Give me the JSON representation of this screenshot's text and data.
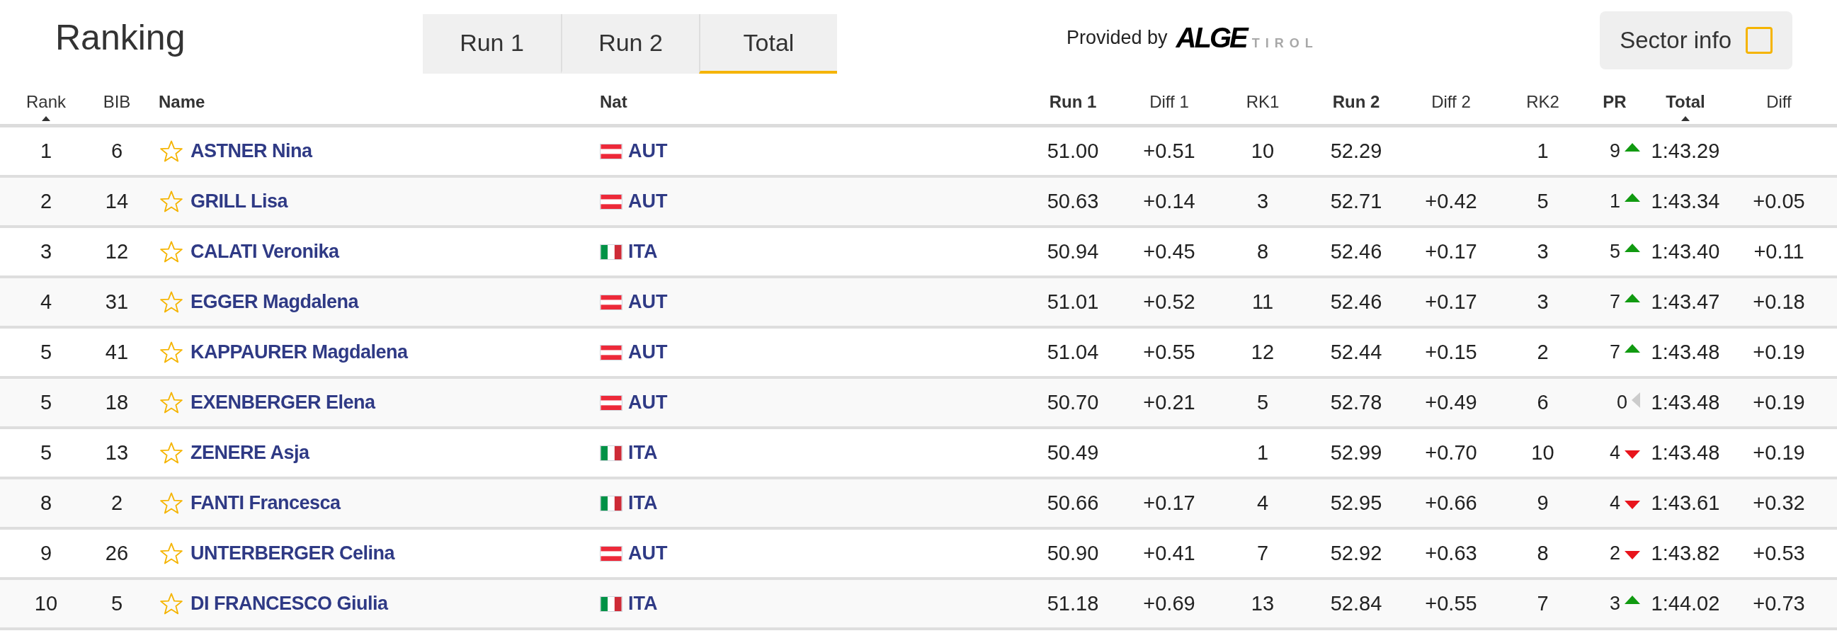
{
  "header": {
    "title": "Ranking",
    "tabs": [
      {
        "label": "Run 1",
        "selected": false
      },
      {
        "label": "Run 2",
        "selected": false
      },
      {
        "label": "Total",
        "selected": true
      }
    ],
    "provider": {
      "label": "Provided by",
      "logo_main": "ALGE",
      "logo_sub": "TIROL"
    },
    "sector_info": {
      "label": "Sector info",
      "checked": false
    }
  },
  "table": {
    "columns": [
      {
        "label": "Rank",
        "bold": false,
        "sorted": true
      },
      {
        "label": "BIB",
        "bold": false,
        "sorted": false
      },
      {
        "label": "Name",
        "bold": true,
        "sorted": false
      },
      {
        "label": "Nat",
        "bold": true,
        "sorted": false
      },
      {
        "label": "Run 1",
        "bold": true,
        "sorted": false
      },
      {
        "label": "Diff 1",
        "bold": false,
        "sorted": false
      },
      {
        "label": "RK1",
        "bold": false,
        "sorted": false
      },
      {
        "label": "Run 2",
        "bold": true,
        "sorted": false
      },
      {
        "label": "Diff 2",
        "bold": false,
        "sorted": false
      },
      {
        "label": "RK2",
        "bold": false,
        "sorted": false
      },
      {
        "label": "PR",
        "bold": true,
        "sorted": false
      },
      {
        "label": "Total",
        "bold": true,
        "sorted": true
      },
      {
        "label": "Diff",
        "bold": false,
        "sorted": false
      }
    ],
    "rows": [
      {
        "rank": "1",
        "bib": "6",
        "favorite": false,
        "name": "ASTNER Nina",
        "nation": {
          "kind": "austria",
          "code": "AUT"
        },
        "run1": "51.00",
        "diff1": "+0.51",
        "rk1": "10",
        "run2": "52.29",
        "rk2": "1",
        "pr": {
          "kind": "up",
          "places": "9"
        },
        "total": "1:43.29"
      },
      {
        "rank": "2",
        "bib": "14",
        "favorite": false,
        "name": "GRILL Lisa",
        "nation": {
          "kind": "austria",
          "code": "AUT"
        },
        "run1": "50.63",
        "diff1": "+0.14",
        "rk1": "3",
        "run2": "52.71",
        "diff2": "+0.42",
        "rk2": "5",
        "pr": {
          "kind": "up",
          "places": "1"
        },
        "total": "1:43.34",
        "diff": "+0.05"
      },
      {
        "rank": "3",
        "bib": "12",
        "favorite": false,
        "name": "CALATI Veronika",
        "nation": {
          "kind": "italy",
          "code": "ITA"
        },
        "run1": "50.94",
        "diff1": "+0.45",
        "rk1": "8",
        "run2": "52.46",
        "diff2": "+0.17",
        "rk2": "3",
        "pr": {
          "kind": "up",
          "places": "5"
        },
        "total": "1:43.40",
        "diff": "+0.11"
      },
      {
        "rank": "4",
        "bib": "31",
        "favorite": false,
        "name": "EGGER Magdalena",
        "nation": {
          "kind": "austria",
          "code": "AUT"
        },
        "run1": "51.01",
        "diff1": "+0.52",
        "rk1": "11",
        "run2": "52.46",
        "diff2": "+0.17",
        "rk2": "3",
        "pr": {
          "kind": "up",
          "places": "7"
        },
        "total": "1:43.47",
        "diff": "+0.18"
      },
      {
        "rank": "5",
        "bib": "41",
        "favorite": false,
        "name": "KAPPAURER Magdalena",
        "nation": {
          "kind": "austria",
          "code": "AUT"
        },
        "run1": "51.04",
        "diff1": "+0.55",
        "rk1": "12",
        "run2": "52.44",
        "diff2": "+0.15",
        "rk2": "2",
        "pr": {
          "kind": "up",
          "places": "7"
        },
        "total": "1:43.48",
        "diff": "+0.19"
      },
      {
        "rank": "5",
        "bib": "18",
        "favorite": false,
        "name": "EXENBERGER Elena",
        "nation": {
          "kind": "austria",
          "code": "AUT"
        },
        "run1": "50.70",
        "diff1": "+0.21",
        "rk1": "5",
        "run2": "52.78",
        "diff2": "+0.49",
        "rk2": "6",
        "pr": {
          "kind": "same",
          "places": "0"
        },
        "total": "1:43.48",
        "diff": "+0.19"
      },
      {
        "rank": "5",
        "bib": "13",
        "favorite": false,
        "name": "ZENERE Asja",
        "nation": {
          "kind": "italy",
          "code": "ITA"
        },
        "run1": "50.49",
        "rk1": "1",
        "run2": "52.99",
        "diff2": "+0.70",
        "rk2": "10",
        "pr": {
          "kind": "down",
          "places": "4"
        },
        "total": "1:43.48",
        "diff": "+0.19"
      },
      {
        "rank": "8",
        "bib": "2",
        "favorite": false,
        "name": "FANTI Francesca",
        "nation": {
          "kind": "italy",
          "code": "ITA"
        },
        "run1": "50.66",
        "diff1": "+0.17",
        "rk1": "4",
        "run2": "52.95",
        "diff2": "+0.66",
        "rk2": "9",
        "pr": {
          "kind": "down",
          "places": "4"
        },
        "total": "1:43.61",
        "diff": "+0.32"
      },
      {
        "rank": "9",
        "bib": "26",
        "favorite": false,
        "name": "UNTERBERGER Celina",
        "nation": {
          "kind": "austria",
          "code": "AUT"
        },
        "run1": "50.90",
        "diff1": "+0.41",
        "rk1": "7",
        "run2": "52.92",
        "diff2": "+0.63",
        "rk2": "8",
        "pr": {
          "kind": "down",
          "places": "2"
        },
        "total": "1:43.82",
        "diff": "+0.53"
      },
      {
        "rank": "10",
        "bib": "5",
        "favorite": false,
        "name": "DI FRANCESCO Giulia",
        "nation": {
          "kind": "italy",
          "code": "ITA"
        },
        "run1": "51.18",
        "diff1": "+0.69",
        "rk1": "13",
        "run2": "52.84",
        "diff2": "+0.55",
        "rk2": "7",
        "pr": {
          "kind": "up",
          "places": "3"
        },
        "total": "1:44.02",
        "diff": "+0.73"
      }
    ]
  }
}
